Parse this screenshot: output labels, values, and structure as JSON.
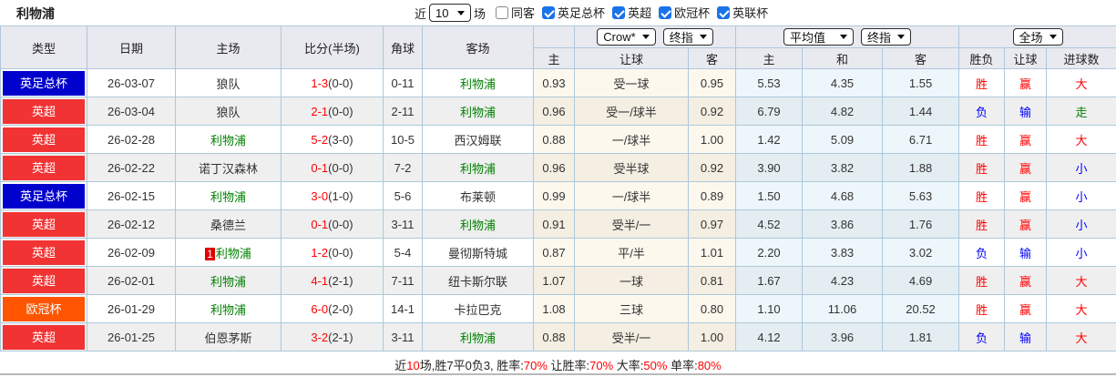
{
  "title": "利物浦",
  "topbar": {
    "near_label": "近",
    "matches_count": "10",
    "games_label": "场",
    "filters": [
      {
        "label": "同客",
        "checked": false
      },
      {
        "label": "英足总杯",
        "checked": true
      },
      {
        "label": "英超",
        "checked": true
      },
      {
        "label": "欧冠杯",
        "checked": true
      },
      {
        "label": "英联杯",
        "checked": true
      }
    ]
  },
  "table": {
    "columns": [
      "类型",
      "日期",
      "主场",
      "比分(半场)",
      "角球",
      "客场"
    ],
    "dropdowns": [
      {
        "label": "Crow*"
      },
      {
        "label": "终指"
      },
      {
        "label": "平均值"
      },
      {
        "label": "终指"
      },
      {
        "label": "全场"
      }
    ],
    "subheaders": [
      "主",
      "让球",
      "客",
      "主",
      "和",
      "客",
      "胜负",
      "让球",
      "进球数"
    ],
    "rows": [
      {
        "league": "英足总杯",
        "league_key": "fa",
        "date": "26-03-07",
        "home": "狼队",
        "home_rank": "",
        "score": "1-3",
        "half_score": "(0-0)",
        "corners": "0-11",
        "away": "利物浦",
        "asian": [
          "0.93",
          "受一球",
          "0.95"
        ],
        "europe": [
          "5.53",
          "4.35",
          "1.55"
        ],
        "results": [
          {
            "t": "胜",
            "c": "red"
          },
          {
            "t": "赢",
            "c": "red"
          },
          {
            "t": "大",
            "c": "red"
          }
        ]
      },
      {
        "league": "英超",
        "league_key": "epl",
        "date": "26-03-04",
        "home": "狼队",
        "home_rank": "",
        "score": "2-1",
        "half_score": "(0-0)",
        "corners": "2-11",
        "away": "利物浦",
        "asian": [
          "0.96",
          "受一/球半",
          "0.92"
        ],
        "europe": [
          "6.79",
          "4.82",
          "1.44"
        ],
        "results": [
          {
            "t": "负",
            "c": "blue"
          },
          {
            "t": "输",
            "c": "blue"
          },
          {
            "t": "走",
            "c": "green"
          }
        ]
      },
      {
        "league": "英超",
        "league_key": "epl",
        "date": "26-02-28",
        "home": "利物浦",
        "home_rank": "",
        "score": "5-2",
        "half_score": "(3-0)",
        "corners": "10-5",
        "away": "西汉姆联",
        "asian": [
          "0.88",
          "一/球半",
          "1.00"
        ],
        "europe": [
          "1.42",
          "5.09",
          "6.71"
        ],
        "results": [
          {
            "t": "胜",
            "c": "red"
          },
          {
            "t": "赢",
            "c": "red"
          },
          {
            "t": "大",
            "c": "red"
          }
        ]
      },
      {
        "league": "英超",
        "league_key": "epl",
        "date": "26-02-22",
        "home": "诺丁汉森林",
        "home_rank": "",
        "score": "0-1",
        "half_score": "(0-0)",
        "corners": "7-2",
        "away": "利物浦",
        "asian": [
          "0.96",
          "受半球",
          "0.92"
        ],
        "europe": [
          "3.90",
          "3.82",
          "1.88"
        ],
        "results": [
          {
            "t": "胜",
            "c": "red"
          },
          {
            "t": "赢",
            "c": "red"
          },
          {
            "t": "小",
            "c": "blue"
          }
        ]
      },
      {
        "league": "英足总杯",
        "league_key": "fa",
        "date": "26-02-15",
        "home": "利物浦",
        "home_rank": "",
        "score": "3-0",
        "half_score": "(1-0)",
        "corners": "5-6",
        "away": "布莱顿",
        "asian": [
          "0.99",
          "一/球半",
          "0.89"
        ],
        "europe": [
          "1.50",
          "4.68",
          "5.63"
        ],
        "results": [
          {
            "t": "胜",
            "c": "red"
          },
          {
            "t": "赢",
            "c": "red"
          },
          {
            "t": "小",
            "c": "blue"
          }
        ]
      },
      {
        "league": "英超",
        "league_key": "epl",
        "date": "26-02-12",
        "home": "桑德兰",
        "home_rank": "",
        "score": "0-1",
        "half_score": "(0-0)",
        "corners": "3-11",
        "away": "利物浦",
        "asian": [
          "0.91",
          "受半/一",
          "0.97"
        ],
        "europe": [
          "4.52",
          "3.86",
          "1.76"
        ],
        "results": [
          {
            "t": "胜",
            "c": "red"
          },
          {
            "t": "赢",
            "c": "red"
          },
          {
            "t": "小",
            "c": "blue"
          }
        ]
      },
      {
        "league": "英超",
        "league_key": "epl",
        "date": "26-02-09",
        "home": "利物浦",
        "home_rank": "1",
        "score": "1-2",
        "half_score": "(0-0)",
        "corners": "5-4",
        "away": "曼彻斯特城",
        "asian": [
          "0.87",
          "平/半",
          "1.01"
        ],
        "europe": [
          "2.20",
          "3.83",
          "3.02"
        ],
        "results": [
          {
            "t": "负",
            "c": "blue"
          },
          {
            "t": "输",
            "c": "blue"
          },
          {
            "t": "小",
            "c": "blue"
          }
        ]
      },
      {
        "league": "英超",
        "league_key": "epl",
        "date": "26-02-01",
        "home": "利物浦",
        "home_rank": "",
        "score": "4-1",
        "half_score": "(2-1)",
        "corners": "7-11",
        "away": "纽卡斯尔联",
        "asian": [
          "1.07",
          "一球",
          "0.81"
        ],
        "europe": [
          "1.67",
          "4.23",
          "4.69"
        ],
        "results": [
          {
            "t": "胜",
            "c": "red"
          },
          {
            "t": "赢",
            "c": "red"
          },
          {
            "t": "大",
            "c": "red"
          }
        ]
      },
      {
        "league": "欧冠杯",
        "league_key": "ucl",
        "date": "26-01-29",
        "home": "利物浦",
        "home_rank": "",
        "score": "6-0",
        "half_score": "(2-0)",
        "corners": "14-1",
        "away": "卡拉巴克",
        "asian": [
          "1.08",
          "三球",
          "0.80"
        ],
        "europe": [
          "1.10",
          "11.06",
          "20.52"
        ],
        "results": [
          {
            "t": "胜",
            "c": "red"
          },
          {
            "t": "赢",
            "c": "red"
          },
          {
            "t": "大",
            "c": "red"
          }
        ]
      },
      {
        "league": "英超",
        "league_key": "epl",
        "date": "26-01-25",
        "home": "伯恩茅斯",
        "home_rank": "",
        "score": "3-2",
        "half_score": "(2-1)",
        "corners": "3-11",
        "away": "利物浦",
        "asian": [
          "0.88",
          "受半/一",
          "1.00"
        ],
        "europe": [
          "4.12",
          "3.96",
          "1.81"
        ],
        "results": [
          {
            "t": "负",
            "c": "blue"
          },
          {
            "t": "输",
            "c": "blue"
          },
          {
            "t": "大",
            "c": "red"
          }
        ]
      }
    ]
  },
  "footer": {
    "segments": [
      {
        "text": "近",
        "c": "black"
      },
      {
        "text": "10",
        "c": "red"
      },
      {
        "text": "场,胜7平0负3, 胜率:",
        "c": "black"
      },
      {
        "text": "70%",
        "c": "red"
      },
      {
        "text": " 让胜率:",
        "c": "black"
      },
      {
        "text": "70%",
        "c": "red"
      },
      {
        "text": " 大率:",
        "c": "black"
      },
      {
        "text": "50%",
        "c": "red"
      },
      {
        "text": " 单率:",
        "c": "black"
      },
      {
        "text": "80%",
        "c": "red"
      }
    ]
  },
  "colors": {
    "league_fa_cup": "#0000cc",
    "league_epl": "#f23333",
    "league_ucl": "#ff5500",
    "liverpool_name": "#008000",
    "score": "#ff0000",
    "result_win": "#ff0000",
    "result_lose": "#0000ff",
    "result_push": "#008000",
    "checkbox": "#1a73e8",
    "header_bg": "#e9e9f0",
    "asian_odds_bg": "#fdf8ee",
    "europe_odds_bg": "#edf6fa",
    "border": "#adc8da"
  }
}
